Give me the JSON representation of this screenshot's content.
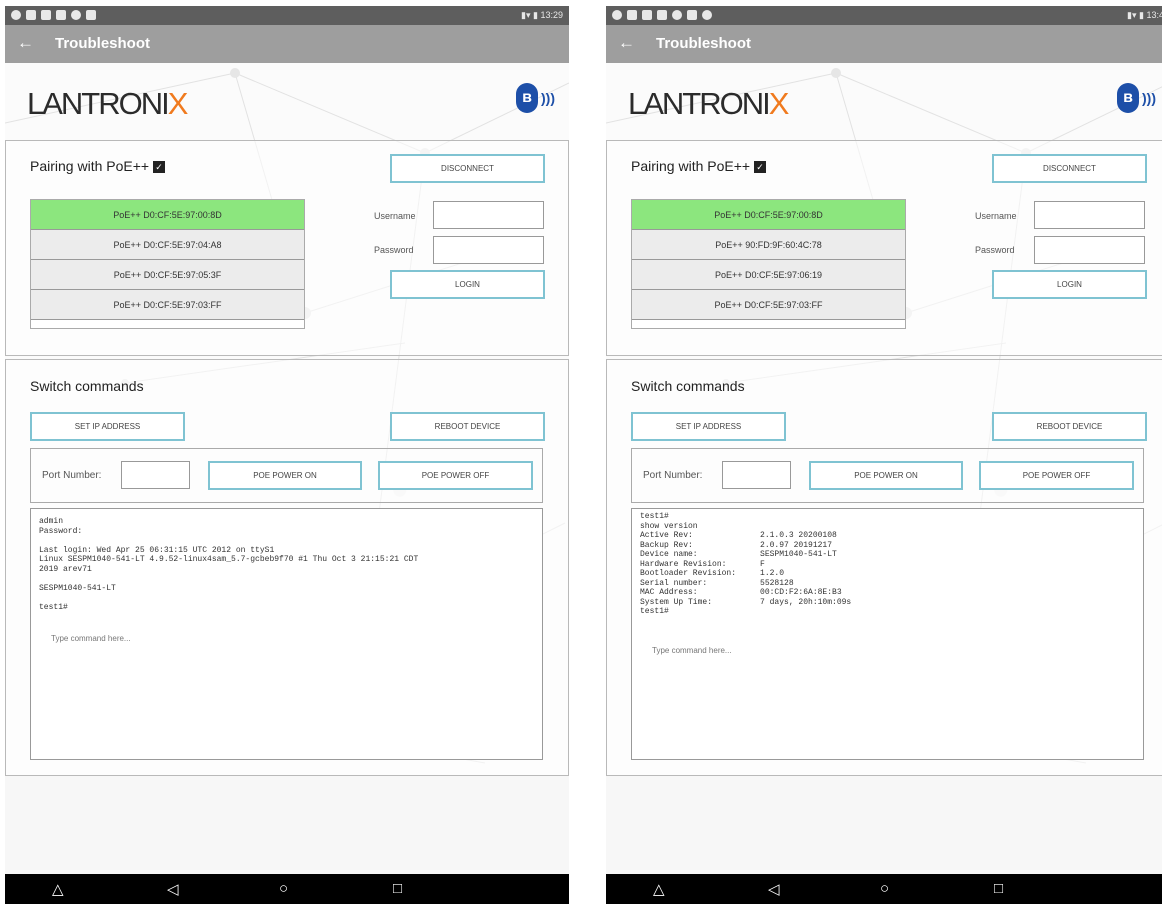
{
  "phones": [
    {
      "status_time": "13:29",
      "app_title": "Troubleshoot",
      "logo": {
        "main": "LANTRONI",
        "accent": "X"
      },
      "pairing": {
        "title": "Pairing with PoE++",
        "disconnect": "DISCONNECT",
        "username_label": "Username",
        "password_label": "Password",
        "login": "LOGIN",
        "devices": [
          "PoE++ D0:CF:5E:97:00:8D",
          "PoE++ D0:CF:5E:97:04:A8",
          "PoE++ D0:CF:5E:97:05:3F",
          "PoE++ D0:CF:5E:97:03:FF"
        ]
      },
      "switch": {
        "title": "Switch commands",
        "set_ip": "SET IP ADDRESS",
        "reboot": "REBOOT DEVICE",
        "port_label": "Port Number:",
        "poe_on": "POE POWER ON",
        "poe_off": "POE POWER OFF",
        "terminal": "admin\nPassword:\n\nLast login: Wed Apr 25 06:31:15 UTC 2012 on ttyS1\nLinux SESPM1040-541-LT 4.9.52-linux4sam_5.7-gcbeb9f70 #1 Thu Oct 3 21:15:21 CDT\n2019 arev71\n\nSESPM1040-541-LT\n\ntest1#",
        "placeholder": "Type command here..."
      }
    },
    {
      "status_time": "13:4",
      "app_title": "Troubleshoot",
      "logo": {
        "main": "LANTRONI",
        "accent": "X"
      },
      "pairing": {
        "title": "Pairing with PoE++",
        "disconnect": "DISCONNECT",
        "username_label": "Username",
        "password_label": "Password",
        "login": "LOGIN",
        "devices": [
          "PoE++ D0:CF:5E:97:00:8D",
          "PoE++ 90:FD:9F:60:4C:78",
          "PoE++ D0:CF:5E:97:06:19",
          "PoE++ D0:CF:5E:97:03:FF"
        ]
      },
      "switch": {
        "title": "Switch commands",
        "set_ip": "SET IP ADDRESS",
        "reboot": "REBOOT DEVICE",
        "port_label": "Port Number:",
        "poe_on": "POE POWER ON",
        "poe_off": "POE POWER OFF",
        "terminal": "test1#\nshow version\nActive Rev:              2.1.0.3 20200108\nBackup Rev:              2.0.97 20191217\nDevice name:             SESPM1040-541-LT\nHardware Revision:       F\nBootloader Revision:     1.2.0\nSerial number:           5528128\nMAC Address:             00:CD:F2:6A:8E:B3\nSystem Up Time:          7 days, 20h:10m:09s\ntest1#",
        "placeholder": "Type command here..."
      }
    }
  ],
  "colors": {
    "active_device": "#8ce67e",
    "button_border": "#7fc3d2",
    "appbar": "#9e9e9e",
    "logo_accent": "#f07a1e",
    "bluetooth": "#1d4fa8"
  }
}
